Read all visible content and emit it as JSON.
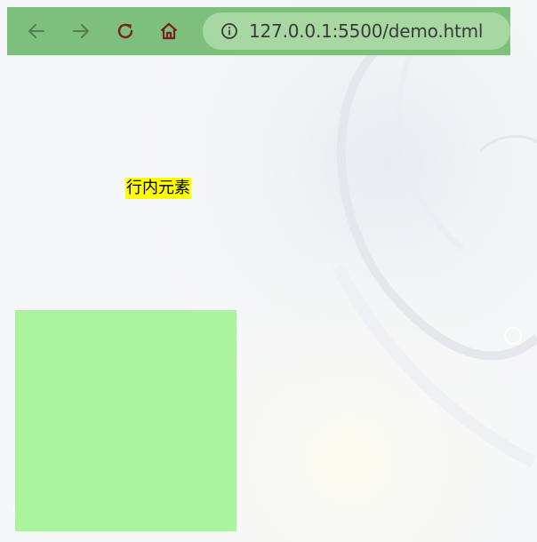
{
  "browser": {
    "url": "127.0.0.1:5500/demo.html",
    "icons": {
      "back": "arrow-left-icon",
      "forward": "arrow-right-icon",
      "reload": "reload-icon",
      "home": "home-icon",
      "info": "info-icon"
    }
  },
  "content": {
    "inline_element_text": "行内元素"
  },
  "colors": {
    "toolbar": "#7cc07c",
    "address_bar": "#a7d8a2",
    "highlight": "#ffff00",
    "green_box": "#acf39f",
    "icon_active": "#7a1f1f",
    "icon_inactive": "#5c7a4f"
  }
}
